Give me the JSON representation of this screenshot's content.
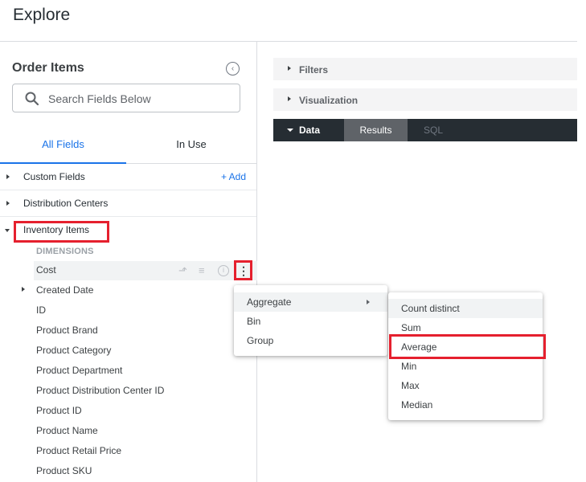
{
  "header": {
    "title": "Explore"
  },
  "sidebar": {
    "explore_name": "Order Items",
    "search_placeholder": "Search Fields Below",
    "tabs": [
      {
        "label": "All Fields"
      },
      {
        "label": "In Use"
      }
    ],
    "groups": [
      {
        "label": "Custom Fields",
        "action": "+ Add"
      },
      {
        "label": "Distribution Centers"
      },
      {
        "label": "Inventory Items"
      }
    ],
    "dimensions_heading": "DIMENSIONS",
    "fields": [
      "Cost",
      "Created Date",
      "ID",
      "Product Brand",
      "Product Category",
      "Product Department",
      "Product Distribution Center ID",
      "Product ID",
      "Product Name",
      "Product Retail Price",
      "Product SKU"
    ]
  },
  "main": {
    "sections": [
      {
        "label": "Filters"
      },
      {
        "label": "Visualization"
      }
    ],
    "data_tabs": [
      {
        "label": "Data"
      },
      {
        "label": "Results"
      },
      {
        "label": "SQL"
      }
    ]
  },
  "context_menu": {
    "items": [
      {
        "label": "Aggregate"
      },
      {
        "label": "Bin"
      },
      {
        "label": "Group"
      }
    ]
  },
  "submenu": {
    "items": [
      {
        "label": "Count distinct"
      },
      {
        "label": "Sum"
      },
      {
        "label": "Average"
      },
      {
        "label": "Min"
      },
      {
        "label": "Max"
      },
      {
        "label": "Median"
      }
    ]
  },
  "colors": {
    "accent": "#1a73e8",
    "highlight": "#e5202e",
    "tab_bar": "#262d33"
  },
  "icons": [
    "collapse-icon",
    "search-icon",
    "pivot-icon",
    "filter-icon",
    "info-icon",
    "more-vert-icon"
  ]
}
